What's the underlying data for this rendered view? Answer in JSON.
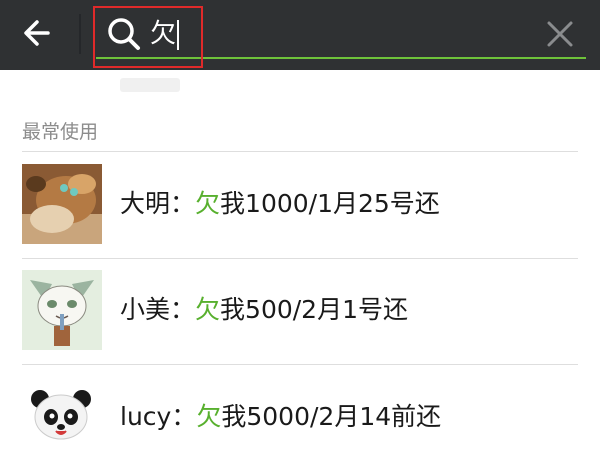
{
  "search": {
    "query": "欠"
  },
  "section": {
    "title": "最常使用"
  },
  "contacts": [
    {
      "name": "大明",
      "separator": "：",
      "match": "欠",
      "rest": "我1000/1月25号还"
    },
    {
      "name": "小美",
      "separator": "：",
      "match": "欠",
      "rest": "我500/2月1号还"
    },
    {
      "name": "lucy",
      "separator": "：",
      "match": "欠",
      "rest": "我5000/2月14前还"
    }
  ],
  "colors": {
    "topbar": "#2f3133",
    "accent_green": "#58b02e",
    "highlight_box": "#e02a2a",
    "section_text": "#8c8c8c"
  },
  "icons": {
    "back": "back-arrow-icon",
    "search": "search-icon",
    "clear": "close-icon"
  }
}
